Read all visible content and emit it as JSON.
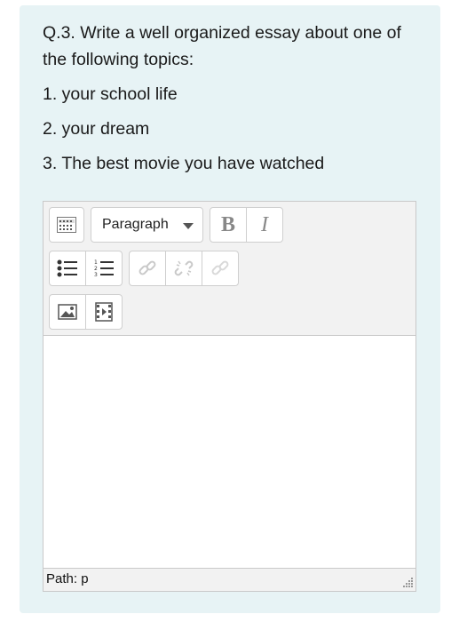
{
  "question": {
    "title": "Q.3. Write a well organized essay about one of the following topics:",
    "topics": [
      "1. your school life",
      "2. your dream",
      "3. The best movie you have watched"
    ]
  },
  "toolbar": {
    "toggle_icon": "toolbar-toggle-icon",
    "format_select": {
      "value": "Paragraph"
    },
    "bold_label": "B",
    "italic_label": "I",
    "row2": [
      "bullet-list-icon",
      "numbered-list-icon",
      "link-icon",
      "unlink-icon",
      "no-autolink-icon"
    ],
    "row3": [
      "image-icon",
      "media-icon"
    ]
  },
  "statusbar": {
    "path": "Path: p"
  },
  "colors": {
    "card_bg": "#e7f3f5",
    "toolbar_bg": "#f2f2f2",
    "border": "#c9c9c9"
  }
}
